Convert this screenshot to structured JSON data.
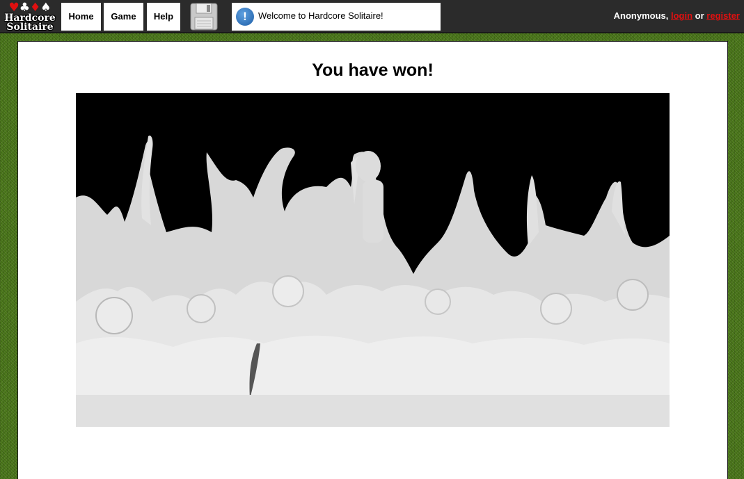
{
  "app": {
    "logo_suits": [
      "♥",
      "♣",
      "♦",
      "♠"
    ],
    "logo_line1": "Hardcore",
    "logo_line2": "Solitaire"
  },
  "nav": {
    "home_label": "Home",
    "game_label": "Game",
    "help_label": "Help"
  },
  "toolbar": {
    "save_icon": "floppy-disk-icon"
  },
  "message": {
    "icon": "info-icon",
    "icon_glyph": "!",
    "text": "Welcome to Hardcore Solitaire!"
  },
  "user": {
    "name": "Anonymous,",
    "login_label": "login",
    "separator": "or",
    "register_label": "register"
  },
  "main": {
    "heading": "You have won!",
    "image": "cheering-crowd-image"
  },
  "colors": {
    "topbar": "#2b2b2b",
    "felt": "#4d7a1c",
    "link": "#e01010",
    "info": "#1e5fa8"
  }
}
